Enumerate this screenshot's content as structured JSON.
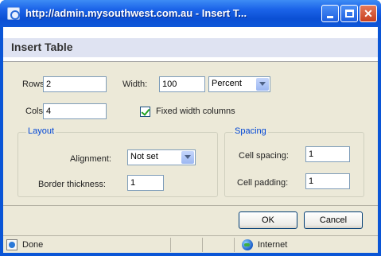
{
  "window": {
    "title": "http://admin.mysouthwest.com.au - Insert T..."
  },
  "dialog": {
    "title": "Insert Table",
    "rows_label": "Rows:",
    "rows_value": "2",
    "cols_label": "Cols:",
    "cols_value": "4",
    "width_label": "Width:",
    "width_value": "100",
    "width_unit": "Percent",
    "fixed_width_label": "Fixed width columns",
    "fixed_width_checked": true,
    "layout": {
      "title": "Layout",
      "alignment_label": "Alignment:",
      "alignment_value": "Not set",
      "border_label": "Border thickness:",
      "border_value": "1"
    },
    "spacing": {
      "title": "Spacing",
      "cell_spacing_label": "Cell spacing:",
      "cell_spacing_value": "1",
      "cell_padding_label": "Cell padding:",
      "cell_padding_value": "1"
    },
    "ok_label": "OK",
    "cancel_label": "Cancel"
  },
  "statusbar": {
    "status_text": "Done",
    "zone_text": "Internet"
  },
  "colors": {
    "titlebar": "#0b4fd4",
    "dialog_bg": "#ece9d8",
    "group_title": "#0046d5"
  }
}
